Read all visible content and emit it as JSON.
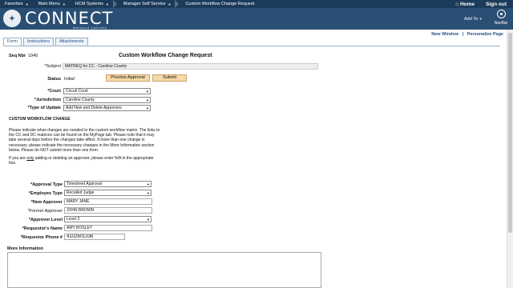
{
  "nav": {
    "items": [
      "Favorites",
      "Main Menu",
      "HCM Systems",
      "Manager Self Service",
      "Custom Workflow Change Request"
    ],
    "home": "Home",
    "signout": "Sign out"
  },
  "banner": {
    "logo_text": "CONNECT",
    "logo_sub": "Maryland Judiciary",
    "add_to": "Add To",
    "navbar": "NavBar"
  },
  "links": {
    "new_window": "New Window",
    "separator": "|",
    "personalize": "Personalize Page"
  },
  "tabs": [
    "Form",
    "Instructions",
    "Attachments"
  ],
  "form": {
    "seq_label": "Seq Nbr",
    "seq_value": "1940",
    "title": "Custom Workflow Change Request",
    "subject_label": "*Subject",
    "subject_value": "MATREQ for CC - Caroline County",
    "status_label": "Status",
    "status_value": "Initial",
    "preview_btn": "Preview Approval",
    "submit_btn": "Submit",
    "court_label": "*Court",
    "court_value": "Circuit Court",
    "jurisdiction_label": "*Jurisdiction",
    "jurisdiction_value": "Caroline County",
    "type_label": "*Type of Update",
    "type_value": "Add New and Delete Approvers",
    "section_title": "CUSTOM WORKFLOW CHANGE",
    "para1": "Please indicate what changes are needed to the custom workflow matrix. The links to the CC and DC matrices can be found on the MyPage tab.  Please note that it may take several days before the changes take effect.  If more than one change is necessary, please indicate the necessary changes in the More Information section below.  Please do NOT submit more than one form.",
    "para2_pre": "If you are ",
    "para2_u": "only",
    "para2_post": " adding or deleting an approver, please enter N/A in the appropriate box.",
    "approval_type_label": "*Approval Type",
    "approval_type_value": "Timesheet Approval",
    "employee_type_label": "*Employee Type",
    "employee_type_value": "Recalled Judge",
    "new_approver_label": "*New Approver",
    "new_approver_value": "MARY JANE",
    "former_approver_label": "*Former Approver",
    "former_approver_value": "JOHN BROWN",
    "approver_level_label": "*Approver Level",
    "approver_level_value": "Level 3",
    "requestor_name_label": "*Requestor's Name",
    "requestor_name_value": "AMY BOSLEY",
    "requestor_phone_label": "*Requestor Phone #",
    "requestor_phone_value": "4102601336",
    "more_info_label": "More Information"
  },
  "icons": {
    "dropdown": "chevron-down-icon",
    "home": "home-icon",
    "navbar": "compass-icon"
  },
  "colors": {
    "nav": "#1c3b5a",
    "banner": "#2a4f74",
    "button": "#f6d9a8",
    "link": "#1f4e8a"
  }
}
